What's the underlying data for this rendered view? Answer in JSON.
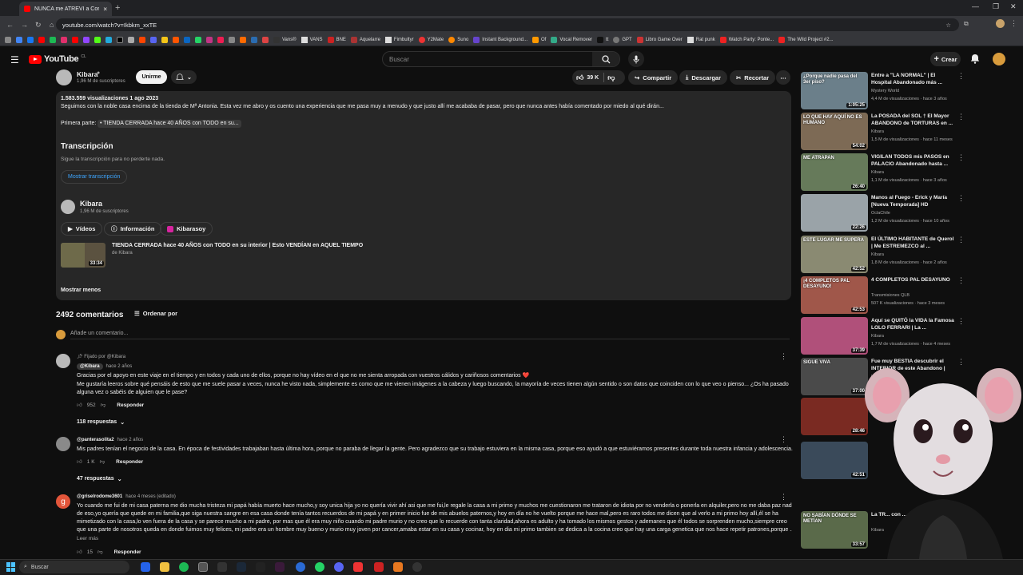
{
  "browser": {
    "tab_title": "NUNCA me ATREVÍ a Contar al...",
    "url": "youtube.com/watch?v=Ikbkm_xxTE",
    "bookmarks": [
      "Vans®",
      "VANS",
      "BNE",
      "Aquelarre",
      "Fimbultyr",
      "Y2Mate",
      "Suno",
      "Instant Background...",
      "Of",
      "Vocal Remover",
      "tt",
      "GPT",
      "Libro Game Over",
      "Rat punk",
      "Watch Party: Ponte...",
      "The Wild Project #2..."
    ]
  },
  "yt": {
    "logo": "YouTube",
    "logo_country": "CL",
    "search_placeholder": "Buscar",
    "create": "Crear"
  },
  "channel": {
    "name": "Kibara",
    "subs": "1,96 M de suscriptores",
    "join": "Unirme",
    "likes": "39 K",
    "share": "Compartir",
    "download": "Descargar",
    "clip": "Recortar"
  },
  "description": {
    "stats": "1.583.559 visualizaciones  1 ago 2023",
    "line1": "Seguimos con la noble casa encima de la tienda de Mª Antonia. Esta vez me abro y os cuento una experiencia que me pasa muy a menudo y que justo allí me acababa de pasar, pero que nunca antes había comentado por miedo al qué dirán...",
    "first_part_label": "Primera parte:",
    "first_part_link": "• TIENDA CERRADA hace 40 AÑOS con TODO en su...",
    "transcript_title": "Transcripción",
    "transcript_sub": "Sigue la transcripción para no perderte nada.",
    "transcript_btn": "Mostrar transcripción",
    "ch_name": "Kibara",
    "ch_subs": "1,96 M de suscriptores",
    "tab_videos": "Vídeos",
    "tab_info": "Información",
    "tab_insta": "Kibarasoy",
    "video_title": "TIENDA CERRADA hace 40 AÑOS con TODO en su interior | Esto VENDÍAN en AQUEL TIEMPO",
    "video_by": "de Kibara",
    "video_dur": "33:34",
    "less": "Mostrar menos"
  },
  "comments": {
    "count": "2492 comentarios",
    "sort": "Ordenar por",
    "add": "Añade un comentario...",
    "items": [
      {
        "pinned": "Fijado por @Kibara",
        "author": "@Kibara",
        "time": "hace 2 años",
        "text1": "Gracias por el apoyo en este viaje en el tiempo y en todos y cada uno de ellos, porque no hay vídeo en el que no me sienta arropada con vuestros cálidos y cariñosos comentarios ❤️",
        "text2": "Me gustaría leeros sobre qué pensáis de esto que me suele pasar a veces, nunca he visto nada, simplemente es como que me vienen imágenes a la cabeza y luego buscando, la mayoría de veces tienen algún sentido o son datos que coinciden con lo que veo o pienso... ¿Os ha pasado",
        "text3": "alguna vez o sabéis de alguien que le pase?",
        "likes": "952",
        "reply": "Responder",
        "replies": "118 respuestas"
      },
      {
        "author": "@panterasolita2",
        "time": "hace 2 años",
        "text1": "Mis padres tenían el negocio de la casa. En época de festividades trabajaban hasta última hora, porque no paraba de llegar la gente. Pero agradezco que su trabajo estuviera en la misma casa, porque eso ayudó a que estuviéramos presentes durante toda nuestra infancia y adolescencia.",
        "likes": "1 K",
        "reply": "Responder",
        "replies": "47 respuestas"
      },
      {
        "author": "@griselrodome3601",
        "time": "hace 4 meses (editado)",
        "text1": "Yo cuando me fui de mi casa paterna me dio mucha tristeza mi papá había muerto hace mucho,y soy unica hija yo no quería vivir ahí asi que me fui,le regale la casa a mi primo y muchos me cuestionaron me trataron de idiota por no venderla o ponerla en alquiler,pero no me daba paz nada",
        "text2": "de eso,yo quería que quede en mi familia,que siga nuestra sangre en esa casa donde tenía tantos recuerdos de mi papá y en primer inicio fue de mis abuelos paternos,y hoy en día no he vuelto porque me hace mal,pero es raro todos me dicen que al verlo a mi primo hoy allí,él se ha",
        "text3": "mimetizado con la casa,lo ven  fuera de la casa y se parece mucho a mi padre, por mas que él era muy niño cuando mi padre murio y no creo que lo recuerde con tanta claridad,ahora es adulto y ha tomado los mismos gestos y ademanes que él todos se sorprenden mucho,siempre creo",
        "text4": "que una parte de nosotros queda en donde fuimos muy felices, mi padre era un hombre muy bueno y murio muy joven por cancer,amaba estar en su casa y cocinar, hoy en dia mi primo tambien se dedica a la cocina creo que hay una carga genetica que nos hace repetir patrones,porque ...",
        "more": "Leer más",
        "likes": "15",
        "reply": "Responder"
      }
    ]
  },
  "sidebar": [
    {
      "title": "Entre a \"LA NORMAL\" | El Hospital Abandonado más ...",
      "channel": "Mystery World",
      "meta": "4,4 M de visualizaciones · hace 3 años",
      "dur": "1:05:25",
      "overlay": "¿Porque nadie pasa del 3er piso?",
      "color": "#6b7f8a"
    },
    {
      "title": "La POSADA del SOL † El Mayor ABANDONO de TORTURAS en ...",
      "channel": "Kibara",
      "meta": "1,5 M de visualizaciones · hace 11 meses",
      "dur": "54:02",
      "overlay": "LO QUE HAY AQUÍ NO ES HUMANO",
      "color": "#7d6a55"
    },
    {
      "title": "VIGILAN TODOS mis PASOS en PALACIO Abandonado hasta ...",
      "channel": "Kibara",
      "meta": "1,1 M de visualizaciones · hace 3 años",
      "dur": "26:40",
      "overlay": "ME ATRAPAN",
      "color": "#667a5a"
    },
    {
      "title": "Manos al Fuego - Erick y María [Nueva Temporada] HD",
      "channel": "OclaChile",
      "meta": "1,2 M de visualizaciones · hace 10 años",
      "dur": "22:26",
      "overlay": "",
      "color": "#9aa3a8"
    },
    {
      "title": "El ÚLTIMO HABITANTE de Querol | Me ESTREMEZCO al ...",
      "channel": "Kibara",
      "meta": "1,8 M de visualizaciones · hace 2 años",
      "dur": "42:52",
      "overlay": "ESTE LUGAR ME SUPERA",
      "color": "#8a8a72"
    },
    {
      "title": "4 COMPLETOS PAL DESAYUNO",
      "channel": "Transmisiones QLB",
      "meta": "507 K visualizaciones · hace 3 meses",
      "dur": "42:53",
      "overlay": "¡4 COMPLETOS PAL DESAYUNO!",
      "color": "#a0574a"
    },
    {
      "title": "Aquí se QUITÓ la VIDA la Famosa LOLO FERRARI | La ...",
      "channel": "Kibara",
      "meta": "1,7 M de visualizaciones · hace 4 meses",
      "dur": "37:39",
      "overlay": "",
      "color": "#b0507a"
    },
    {
      "title": "Fue muy BESTIA descubrir el INTERIOR de este Abandono | D...",
      "channel": "Kibara",
      "meta": "",
      "dur": "37:00",
      "overlay": "SIGUE VIVA",
      "color": "#4a4a4a"
    },
    {
      "title": "",
      "channel": "",
      "meta": "",
      "dur": "28:46",
      "overlay": "",
      "color": "#7a2a22"
    },
    {
      "title": "",
      "channel": "",
      "meta": "",
      "dur": "42:51",
      "overlay": "",
      "color": "#3a4a5a"
    },
    {
      "title": "La TR... con ...",
      "channel": "Kibara",
      "meta": "",
      "dur": "33:57",
      "overlay": "NO SABÍAN DÓNDE SE METÍAN",
      "color": "#5a6a4a"
    }
  ],
  "taskbar": {
    "search": "Buscar"
  }
}
